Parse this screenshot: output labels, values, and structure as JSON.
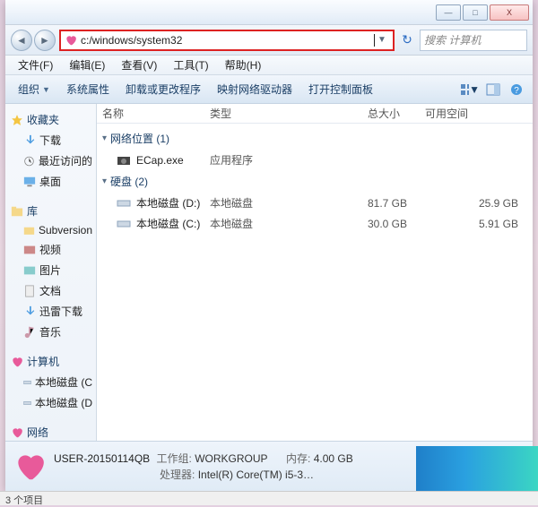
{
  "titlebar": {
    "min": "—",
    "max": "□",
    "close": "X"
  },
  "nav": {
    "back": "◄",
    "fwd": "►",
    "address": "c:/windows/system32",
    "dropdown": "▼",
    "refresh": "↻",
    "search_placeholder": "搜索 计算机"
  },
  "menu": {
    "file": "文件(F)",
    "edit": "编辑(E)",
    "view": "查看(V)",
    "tools": "工具(T)",
    "help": "帮助(H)"
  },
  "toolbar": {
    "organize": "组织",
    "properties": "系统属性",
    "uninstall": "卸载或更改程序",
    "network": "映射网络驱动器",
    "controlpanel": "打开控制面板"
  },
  "columns": {
    "name": "名称",
    "type": "类型",
    "total": "总大小",
    "free": "可用空间"
  },
  "groups": {
    "network_loc": "网络位置 (1)",
    "drives": "硬盘 (2)"
  },
  "items": {
    "ecap": {
      "name": "ECap.exe",
      "type": "应用程序"
    },
    "d": {
      "name": "本地磁盘 (D:)",
      "type": "本地磁盘",
      "total": "81.7 GB",
      "free": "25.9 GB"
    },
    "c": {
      "name": "本地磁盘 (C:)",
      "type": "本地磁盘",
      "total": "30.0 GB",
      "free": "5.91 GB"
    }
  },
  "sidebar": {
    "favorites": "收藏夹",
    "downloads": "下载",
    "recent": "最近访问的",
    "desktop": "桌面",
    "libraries": "库",
    "subversion": "Subversion",
    "video": "视频",
    "pictures": "图片",
    "documents": "文档",
    "xunlei": "迅雷下载",
    "music": "音乐",
    "computer": "计算机",
    "drive_c": "本地磁盘 (C",
    "drive_d": "本地磁盘 (D",
    "network": "网络"
  },
  "details": {
    "pcname": "USER-20150114QB",
    "workgroup_lbl": "工作组:",
    "workgroup": "WORKGROUP",
    "mem_lbl": "内存:",
    "mem": "4.00 GB",
    "cpu_lbl": "处理器:",
    "cpu": "Intel(R) Core(TM) i5-3…"
  },
  "status": "3 个项目"
}
